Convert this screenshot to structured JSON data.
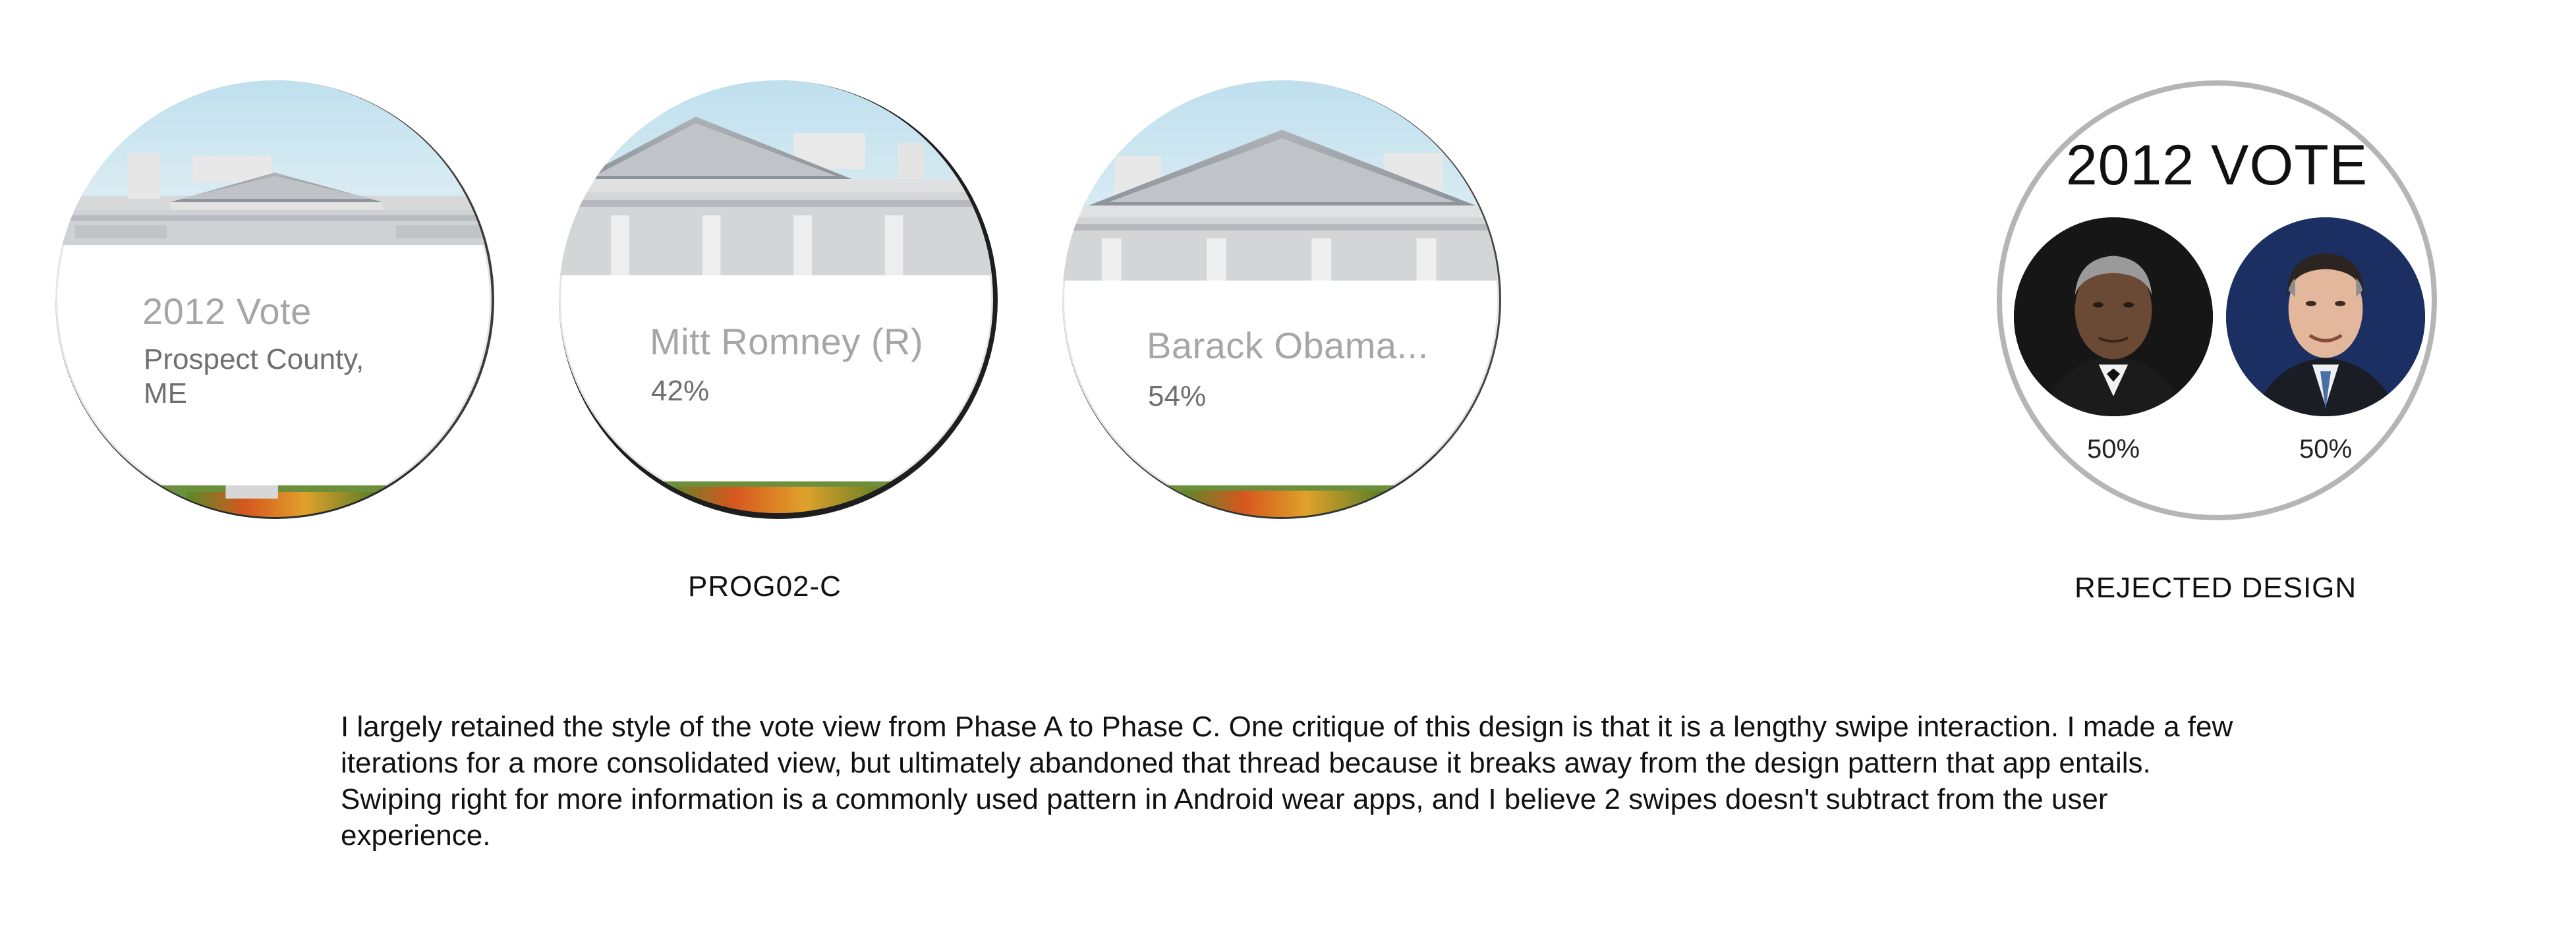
{
  "screens": [
    {
      "title": "2012 Vote",
      "subtitle_line1": "Prospect County,",
      "subtitle_line2": "ME"
    },
    {
      "title": "Mitt Romney (R)",
      "value": "42%"
    },
    {
      "title": "Barack Obama...",
      "value": "54%"
    }
  ],
  "captions": {
    "prototype": "PROG02-C",
    "rejected": "REJECTED DESIGN"
  },
  "rejected_design": {
    "title": "2012 VOTE",
    "candidates": [
      {
        "name": "Barack Obama",
        "percent": "50%"
      },
      {
        "name": "Mitt Romney",
        "percent": "50%"
      }
    ]
  },
  "description": "I largely retained the style of the vote view from Phase A to Phase C. One critique of this design is that it is a lengthy swipe interaction. I made a few iterations for a more consolidated view, but ultimately abandoned that thread because it breaks away from the design pattern that app entails. Swiping right for more information is a commonly used pattern in Android wear apps, and I believe 2 swipes doesn't subtract from the user experience.",
  "colors": {
    "sky": "#cfe6ef",
    "building": "#c9ccd0",
    "text_title": "#a6a6a6",
    "text_sub": "#6f6f6f",
    "ring": "#b5b5b5"
  }
}
